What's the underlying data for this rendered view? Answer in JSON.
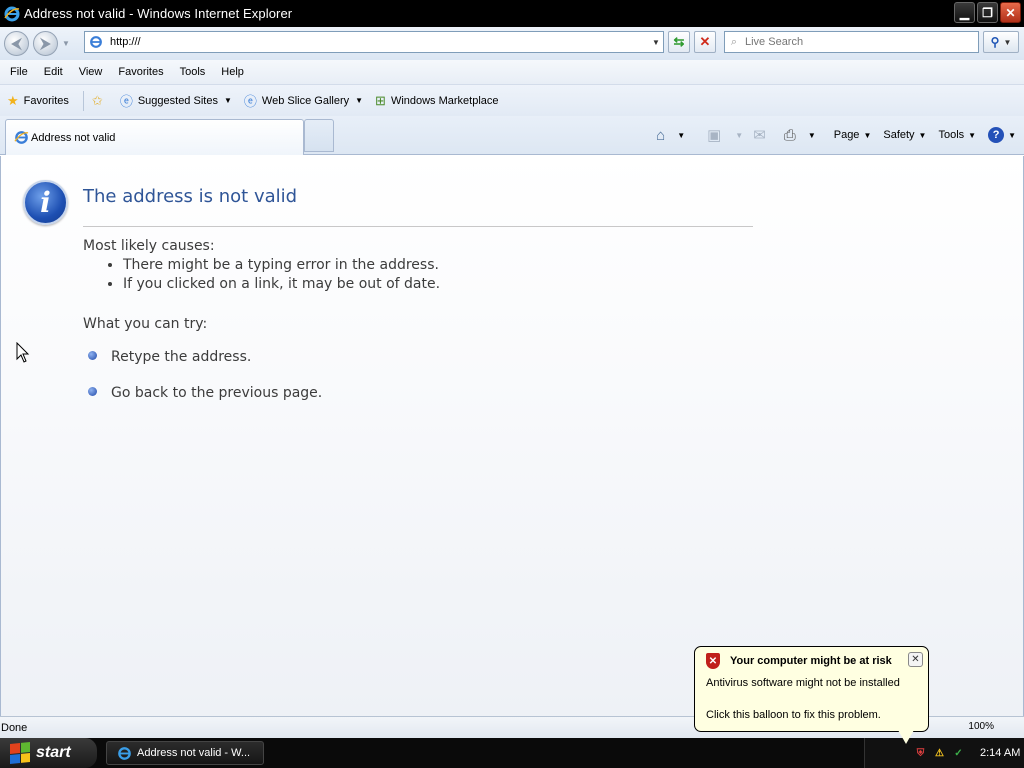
{
  "window": {
    "title": "Address not valid - Windows Internet Explorer",
    "min_glyph": "▁",
    "max_glyph": "❐",
    "close_glyph": "✕"
  },
  "address": {
    "url": "http:///",
    "search_placeholder": "Live Search"
  },
  "menu": [
    "File",
    "Edit",
    "View",
    "Favorites",
    "Tools",
    "Help"
  ],
  "favorites_bar": {
    "favorites_label": "Favorites",
    "suggested_sites": "Suggested Sites",
    "web_slice_gallery": "Web Slice Gallery",
    "windows_marketplace": "Windows Marketplace"
  },
  "tab": {
    "label": "Address not valid"
  },
  "command_bar": {
    "page": "Page",
    "safety": "Safety",
    "tools": "Tools",
    "help_glyph": "?"
  },
  "content": {
    "title": "The address is not valid",
    "causes_heading": "Most likely causes:",
    "causes": [
      "There might be a typing error in the address.",
      "If you clicked on a link, it may be out of date."
    ],
    "try_heading": "What you can try:",
    "try_items": [
      "Retype the address.",
      "Go back to the previous page."
    ]
  },
  "status": {
    "text": "Done",
    "zoom": "100%"
  },
  "taskbar": {
    "start_label": "start",
    "task_item": "Address not valid - W...",
    "clock": "2:14 AM"
  },
  "balloon": {
    "title": "Your computer might be at risk",
    "line1": "Antivirus software might not be installed",
    "line2": "Click this balloon to fix this problem."
  },
  "colors": {
    "title_blue": "#2f5597",
    "balloon_bg": "#ffffe1",
    "titlebar_bg": "#000000"
  }
}
